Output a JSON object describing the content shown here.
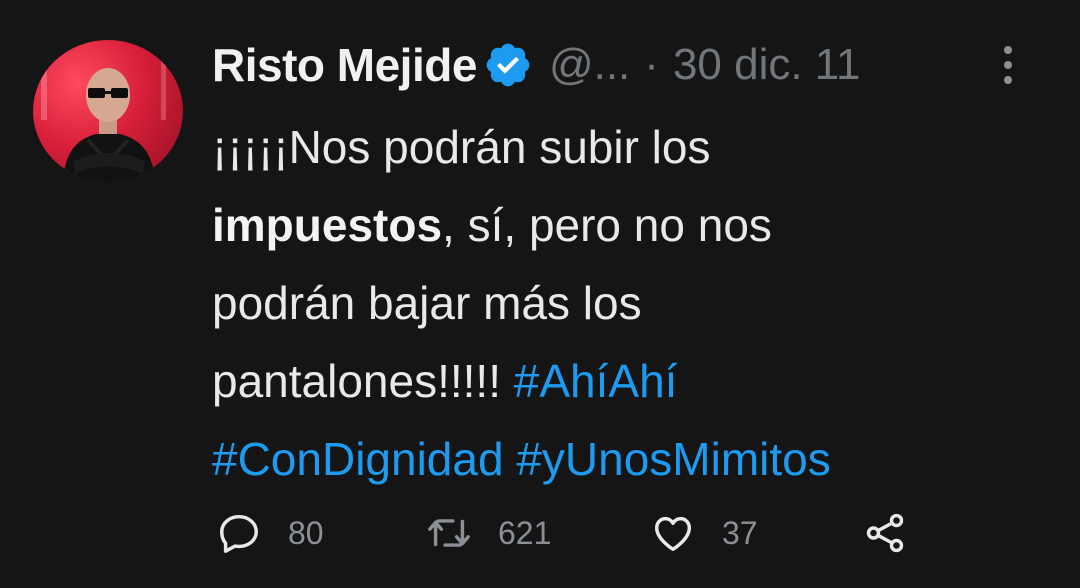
{
  "author": {
    "name": "Risto Mejide",
    "handle": "@...",
    "separator": "·",
    "date": "30 dic. 11"
  },
  "tweet": {
    "line1": "¡¡¡¡¡Nos podrán subir los",
    "bold_word": "impuestos",
    "line2_rest": ", sí, pero no nos",
    "line3": "podrán bajar más los",
    "line4": "pantalones!!!!! ",
    "hashtag1": "#AhíAhí",
    "hashtag2": "#ConDignidad",
    "hashtag3": "#yUnosMimitos"
  },
  "actions": {
    "reply_count": "80",
    "retweet_count": "621",
    "like_count": "37"
  },
  "colors": {
    "background": "#151515",
    "text": "#e7e9ea",
    "secondary": "#71767b",
    "accent": "#1d9bf0"
  },
  "icons": [
    "verified-badge-icon",
    "more-options-icon",
    "reply-icon",
    "retweet-icon",
    "like-icon",
    "share-icon"
  ]
}
